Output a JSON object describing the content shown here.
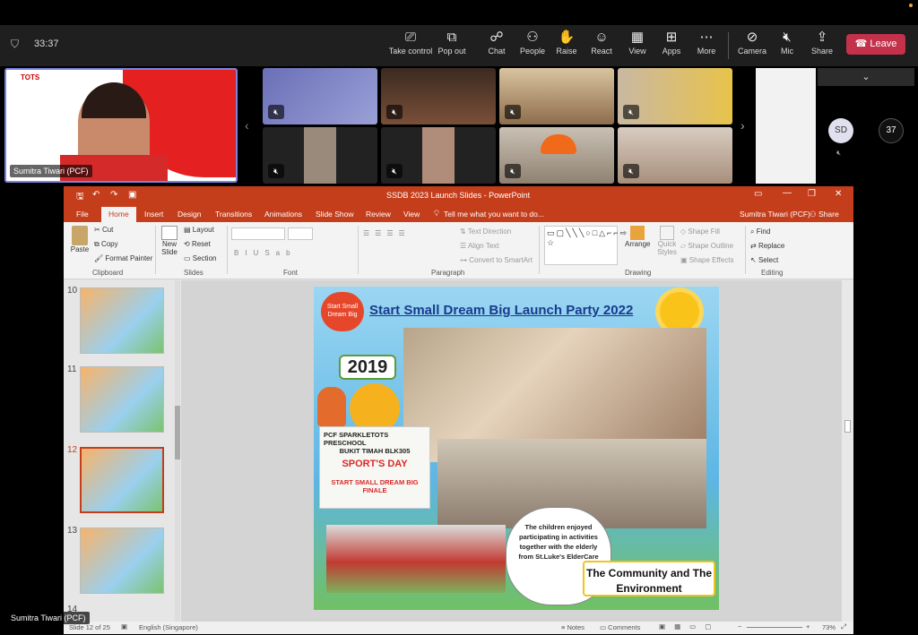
{
  "meeting": {
    "timer": "33:37"
  },
  "toolbar": {
    "take_control": "Take control",
    "pop_out": "Pop out",
    "chat": "Chat",
    "people": "People",
    "raise": "Raise",
    "react": "React",
    "view": "View",
    "apps": "Apps",
    "more": "More",
    "camera": "Camera",
    "mic": "Mic",
    "share": "Share",
    "leave": "Leave"
  },
  "participants": {
    "presenter_name": "Sumitra Tiwari (PCF)",
    "sd_initials": "SD",
    "overflow_count": "37"
  },
  "ppt": {
    "title": "SSDB 2023 Launch Slides - PowerPoint",
    "user": "Sumitra Tiwari (PCF)",
    "share": "Share",
    "tabs": [
      "File",
      "Home",
      "Insert",
      "Design",
      "Transitions",
      "Animations",
      "Slide Show",
      "Review",
      "View"
    ],
    "tell_me": "Tell me what you want to do...",
    "clipboard": {
      "paste": "Paste",
      "cut": "Cut",
      "copy": "Copy",
      "format_painter": "Format Painter",
      "label": "Clipboard"
    },
    "slides_group": {
      "new_slide": "New Slide",
      "layout": "Layout",
      "reset": "Reset",
      "section": "Section",
      "label": "Slides"
    },
    "font_label": "Font",
    "paragraph": {
      "text_direction": "Text Direction",
      "align_text": "Align Text",
      "convert": "Convert to SmartArt",
      "label": "Paragraph"
    },
    "drawing": {
      "arrange": "Arrange",
      "quick_styles": "Quick Styles",
      "shape_fill": "Shape Fill",
      "shape_outline": "Shape Outline",
      "shape_effects": "Shape Effects",
      "label": "Drawing"
    },
    "editing": {
      "find": "Find",
      "replace": "Replace",
      "select": "Select",
      "label": "Editing"
    },
    "thumbs": [
      "10",
      "11",
      "12",
      "13",
      "14"
    ],
    "status": {
      "slide": "Slide 12 of 25",
      "language": "English (Singapore)",
      "notes": "Notes",
      "comments": "Comments",
      "zoom": "73%"
    }
  },
  "slide": {
    "title": "Start Small Dream Big Launch Party 2022",
    "logo": "Start Small Dream Big",
    "year": "2019",
    "sign_line1": "PCF SPARKLETOTS PRESCHOOL",
    "sign_line2": "BUKIT TIMAH BLK305",
    "sign_line3": "SPORT'S DAY",
    "sign_line4": "START SMALL DREAM BIG FINALE",
    "bubble": "The children enjoyed participating in activities together with the elderly from St.Luke's ElderCare",
    "caption": "The Community and The Environment"
  },
  "colors": {
    "accent": "#c43e1c",
    "leave": "#c4314b"
  }
}
